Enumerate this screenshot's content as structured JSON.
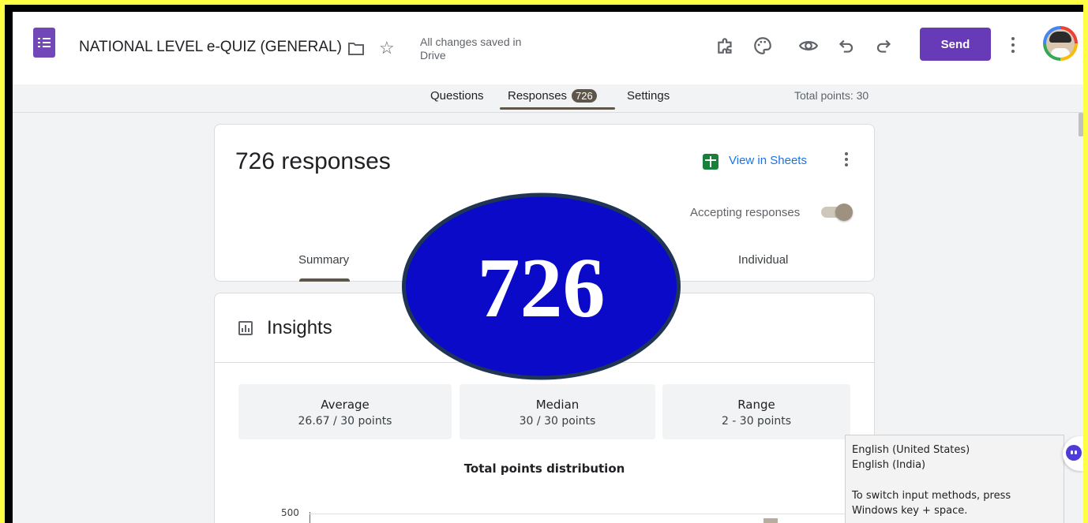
{
  "header": {
    "title": "NATIONAL LEVEL e-QUIZ (GENERAL)",
    "saved_status": "All changes saved in Drive",
    "send_label": "Send"
  },
  "tabs": {
    "questions": "Questions",
    "responses": "Responses",
    "responses_count": "726",
    "settings": "Settings",
    "total_points": "Total points: 30"
  },
  "responses_card": {
    "title": "726 responses",
    "view_in_sheets": "View in Sheets",
    "accepting_label": "Accepting responses",
    "accepting_on": true,
    "summary_tab": "Summary",
    "individual_tab": "Individual"
  },
  "insights": {
    "title": "Insights",
    "stats": [
      {
        "label": "Average",
        "value": "26.67 / 30 points"
      },
      {
        "label": "Median",
        "value": "30 / 30 points"
      },
      {
        "label": "Range",
        "value": "2 - 30 points"
      }
    ],
    "distribution_title": "Total points distribution",
    "y_tick": "500"
  },
  "overlay": {
    "number": "726",
    "fill_color": "#0a0ac8",
    "border_color": "#1f3553"
  },
  "ime_popup": {
    "lang1": "English (United States)",
    "lang2": "English (India)",
    "hint": "To switch input methods, press Windows key + space."
  },
  "icons": [
    "forms-logo-icon",
    "folder-icon",
    "star-icon",
    "addon-puzzle-icon",
    "palette-icon",
    "preview-eye-icon",
    "undo-icon",
    "redo-icon",
    "more-vert-icon",
    "avatar",
    "sheets-icon",
    "insights-chart-icon",
    "assistant-icon"
  ]
}
